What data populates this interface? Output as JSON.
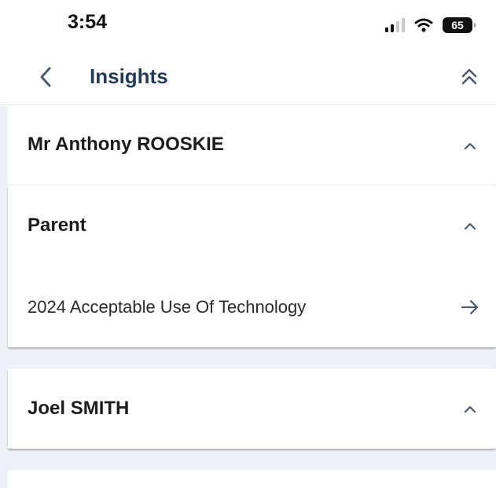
{
  "status": {
    "time": "3:54",
    "battery": "65"
  },
  "nav": {
    "title": "Insights"
  },
  "groups": [
    {
      "name": "Mr Anthony ROOSKIE"
    },
    {
      "name": "Parent",
      "items": [
        {
          "label": "2024 Acceptable Use Of Technology"
        }
      ]
    },
    {
      "name": "Joel SMITH"
    }
  ],
  "colors": {
    "title": "#1f3a5f",
    "background": "#eef1f7",
    "icon": "#4a5a70"
  }
}
